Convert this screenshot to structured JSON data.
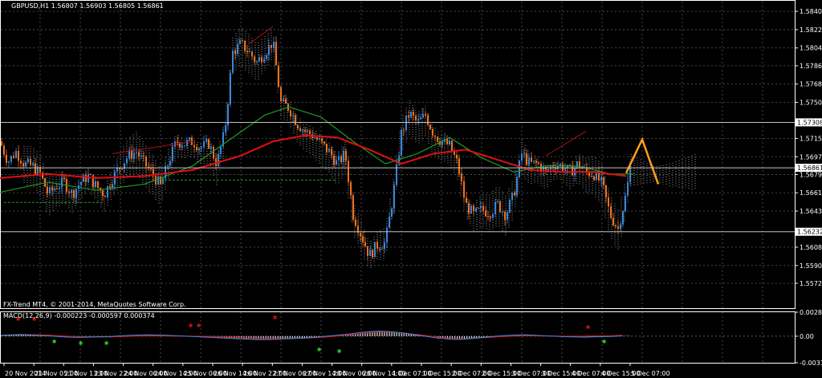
{
  "chart_data": {
    "type": "candlestick",
    "symbol_line": "GBPUSD,H1  1.56807 1.56903 1.56805 1.56861",
    "copyright": "FX-Trend MT4, © 2001-2014, MetaQuotes Software Corp.",
    "macd_label": "MACD(12,26,9) -0.000223 -0.000597 0.000374",
    "price_ylim": [
      1.5548,
      1.5848
    ],
    "price_ticks": [
      "1.58400",
      "1.58220",
      "1.58040",
      "1.57865",
      "1.57685",
      "1.57505",
      "1.57150",
      "1.56970",
      "1.56795",
      "1.56615",
      "1.56435",
      "1.56080",
      "1.55900",
      "1.55725"
    ],
    "highlight_levels": [
      {
        "label": "1.57308",
        "value": 1.57308
      },
      {
        "label": "1.56861",
        "value": 1.56861
      },
      {
        "label": "1.56232",
        "value": 1.56232
      }
    ],
    "macd_ticks": [
      "0.002871",
      "0.00",
      "-0.003177"
    ],
    "x_labels": [
      "20 Nov 2014",
      "21 Nov 05:00",
      "21 Nov 13:00",
      "23 Nov 22:00",
      "24 Nov 06:00",
      "24 Nov 14:00",
      "25 Nov 06:00",
      "26 Nov 14:00",
      "26 Nov 22:00",
      "27 Nov 06:00",
      "27 Nov 14:00",
      "28 Nov 06:00",
      "28 Nov 14:00",
      "1 Dec 07:00",
      "1 Dec 15:00",
      "2 Dec 07:00",
      "2 Dec 15:00",
      "3 Dec 07:00",
      "3 Dec 15:00",
      "4 Dec 07:00",
      "4 Dec 15:00",
      "5 Dec 07:00"
    ],
    "close_path": [
      [
        0,
        1.5712
      ],
      [
        10,
        1.5692
      ],
      [
        20,
        1.5702
      ],
      [
        30,
        1.569
      ],
      [
        40,
        1.5688
      ],
      [
        50,
        1.568
      ],
      [
        60,
        1.566
      ],
      [
        70,
        1.5668
      ],
      [
        80,
        1.5672
      ],
      [
        90,
        1.566
      ],
      [
        100,
        1.5672
      ],
      [
        110,
        1.5678
      ],
      [
        120,
        1.5668
      ],
      [
        130,
        1.566
      ],
      [
        140,
        1.5676
      ],
      [
        150,
        1.5688
      ],
      [
        160,
        1.5698
      ],
      [
        170,
        1.5702
      ],
      [
        180,
        1.569
      ],
      [
        190,
        1.568
      ],
      [
        200,
        1.5668
      ],
      [
        210,
        1.5692
      ],
      [
        220,
        1.5712
      ],
      [
        230,
        1.571
      ],
      [
        240,
        1.5712
      ],
      [
        250,
        1.5706
      ],
      [
        260,
        1.571
      ],
      [
        270,
        1.569
      ],
      [
        280,
        1.5722
      ],
      [
        290,
        1.58
      ],
      [
        300,
        1.5808
      ],
      [
        310,
        1.58
      ],
      [
        320,
        1.579
      ],
      [
        330,
        1.58
      ],
      [
        340,
        1.581
      ],
      [
        350,
        1.575
      ],
      [
        360,
        1.5745
      ],
      [
        370,
        1.573
      ],
      [
        380,
        1.5722
      ],
      [
        390,
        1.5718
      ],
      [
        400,
        1.571
      ],
      [
        410,
        1.5702
      ],
      [
        420,
        1.569
      ],
      [
        430,
        1.57
      ],
      [
        440,
        1.564
      ],
      [
        450,
        1.562
      ],
      [
        460,
        1.56
      ],
      [
        470,
        1.561
      ],
      [
        480,
        1.5612
      ],
      [
        490,
        1.566
      ],
      [
        500,
        1.572
      ],
      [
        510,
        1.574
      ],
      [
        520,
        1.573
      ],
      [
        530,
        1.5738
      ],
      [
        540,
        1.572
      ],
      [
        550,
        1.5712
      ],
      [
        560,
        1.5708
      ],
      [
        570,
        1.569
      ],
      [
        580,
        1.565
      ],
      [
        590,
        1.564
      ],
      [
        600,
        1.5645
      ],
      [
        610,
        1.5642
      ],
      [
        620,
        1.565
      ],
      [
        630,
        1.564
      ],
      [
        640,
        1.566
      ],
      [
        650,
        1.57
      ],
      [
        660,
        1.569
      ],
      [
        670,
        1.569
      ],
      [
        680,
        1.5682
      ],
      [
        690,
        1.569
      ],
      [
        700,
        1.5688
      ],
      [
        710,
        1.5682
      ],
      [
        720,
        1.569
      ],
      [
        730,
        1.5682
      ],
      [
        740,
        1.568
      ],
      [
        750,
        1.567
      ],
      [
        760,
        1.564
      ],
      [
        770,
        1.5626
      ],
      [
        780,
        1.566
      ],
      [
        785,
        1.5686
      ]
    ],
    "ma_red": [
      [
        0,
        1.5676
      ],
      [
        60,
        1.568
      ],
      [
        120,
        1.5676
      ],
      [
        180,
        1.5678
      ],
      [
        240,
        1.5684
      ],
      [
        300,
        1.5698
      ],
      [
        340,
        1.5712
      ],
      [
        380,
        1.5718
      ],
      [
        420,
        1.5716
      ],
      [
        460,
        1.5704
      ],
      [
        500,
        1.569
      ],
      [
        540,
        1.57
      ],
      [
        580,
        1.5704
      ],
      [
        620,
        1.5694
      ],
      [
        660,
        1.5684
      ],
      [
        700,
        1.5682
      ],
      [
        740,
        1.5682
      ],
      [
        780,
        1.5678
      ]
    ],
    "ma_green": [
      [
        0,
        1.5662
      ],
      [
        60,
        1.5672
      ],
      [
        120,
        1.5664
      ],
      [
        180,
        1.567
      ],
      [
        240,
        1.5688
      ],
      [
        290,
        1.5716
      ],
      [
        330,
        1.5738
      ],
      [
        360,
        1.5746
      ],
      [
        400,
        1.5736
      ],
      [
        440,
        1.5712
      ],
      [
        480,
        1.569
      ],
      [
        520,
        1.57
      ],
      [
        560,
        1.5716
      ],
      [
        600,
        1.5696
      ],
      [
        640,
        1.5682
      ],
      [
        680,
        1.5688
      ],
      [
        720,
        1.5688
      ],
      [
        760,
        1.568
      ],
      [
        790,
        1.568
      ]
    ],
    "projection": [
      [
        780,
        1.5681
      ],
      [
        800,
        1.5714
      ],
      [
        820,
        1.567
      ]
    ],
    "macd_hist": [
      0.0004,
      0.0006,
      0.0007,
      0.0005,
      0.0003,
      0.0001,
      -0.0002,
      -0.0004,
      -0.0005,
      -0.0004,
      -0.0003,
      -0.0002,
      0.0001,
      0.0003,
      0.0005,
      0.0006,
      0.0005,
      0.0004,
      0.0002,
      0.0,
      -0.0002,
      -0.0004,
      -0.0006,
      -0.0008,
      -0.001,
      -0.0012,
      -0.0014,
      -0.0015,
      -0.0014,
      -0.0012,
      -0.001,
      -0.0008,
      -0.0005,
      -0.0002,
      0.0002,
      0.0006,
      0.001,
      0.0016,
      0.002,
      0.0022,
      0.002,
      0.0016,
      0.001,
      0.0004,
      -0.0002,
      -0.0008,
      -0.0012,
      -0.0014,
      -0.0012,
      -0.0008,
      -0.0004,
      0.0,
      0.0003,
      0.0005,
      0.0006,
      0.0004,
      0.0002,
      0.0,
      -0.0002,
      -0.0003,
      -0.0004,
      -0.0003,
      -0.0002,
      -0.0001,
      0.0002
    ]
  }
}
